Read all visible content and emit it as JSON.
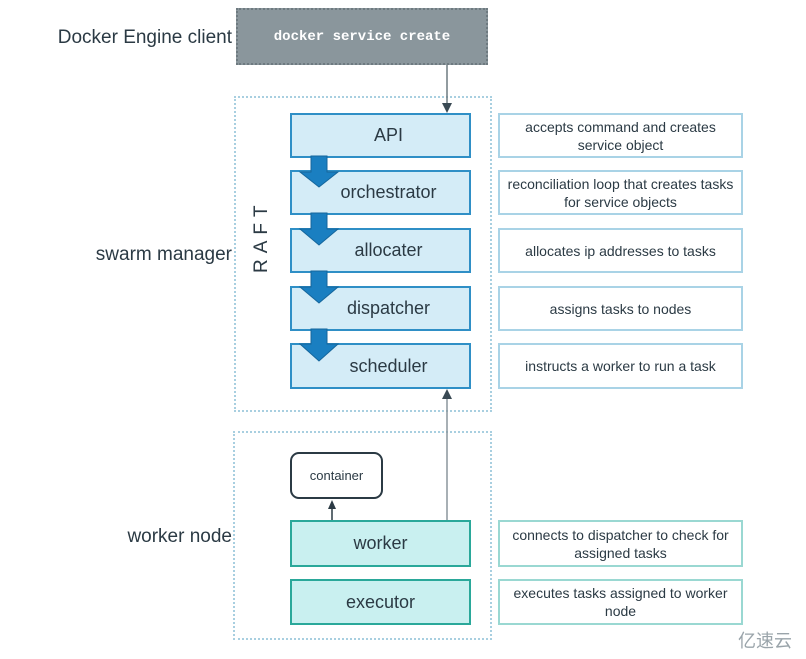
{
  "labels": {
    "client": "Docker Engine client",
    "manager": "swarm manager",
    "worker_node": "worker node",
    "raft": "RAFT"
  },
  "client_command": "docker service create",
  "manager_components": [
    {
      "name": "API",
      "description": "accepts command and creates service object"
    },
    {
      "name": "orchestrator",
      "description": "reconciliation loop that creates tasks for service objects"
    },
    {
      "name": "allocater",
      "description": "allocates ip addresses to tasks"
    },
    {
      "name": "dispatcher",
      "description": "assigns tasks to nodes"
    },
    {
      "name": "scheduler",
      "description": "instructs a worker to run a task"
    }
  ],
  "worker_components": [
    {
      "name": "worker",
      "description": "connects to dispatcher to check for assigned tasks"
    },
    {
      "name": "executor",
      "description": "executes tasks assigned to worker node"
    }
  ],
  "container_label": "container",
  "watermark": "亿速云",
  "colors": {
    "client": "#8a969c",
    "manager_fill": "#d4ecf7",
    "manager_border": "#2f8fc6",
    "worker_fill": "#c9f0f0",
    "worker_border": "#2aa89a",
    "flow_arrow": "#1a7fc1"
  }
}
